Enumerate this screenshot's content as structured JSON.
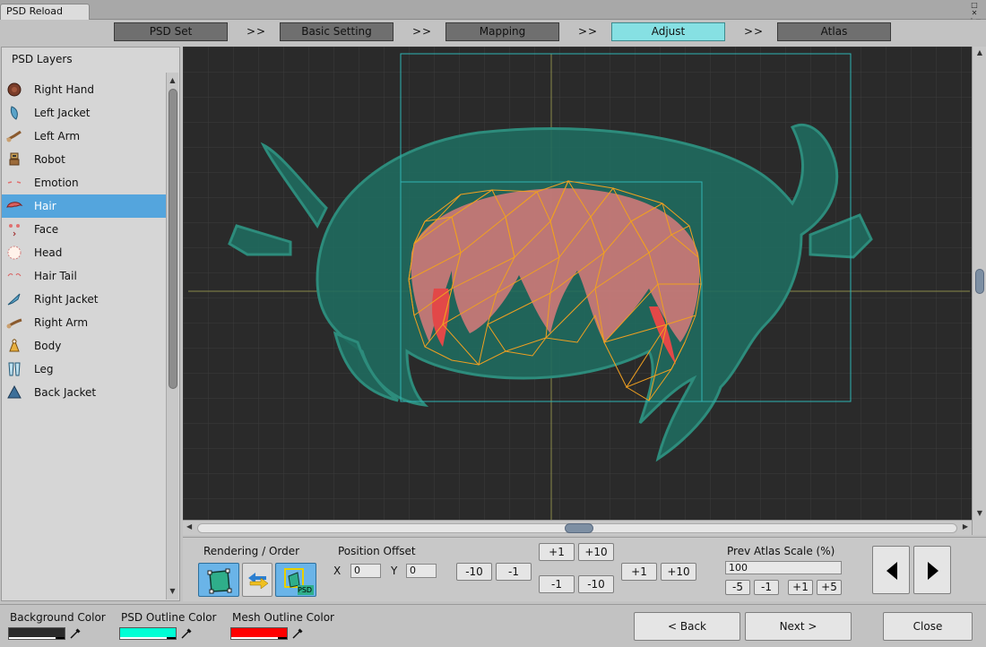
{
  "window": {
    "title": "PSD Reload"
  },
  "steps": [
    {
      "label": "PSD Set",
      "active": false
    },
    {
      "label": "Basic Setting",
      "active": false
    },
    {
      "label": "Mapping",
      "active": false
    },
    {
      "label": "Adjust",
      "active": true
    },
    {
      "label": "Atlas",
      "active": false
    }
  ],
  "step_separator": ">>",
  "layers_panel": {
    "title": "PSD Layers",
    "selected": "Hair",
    "items": [
      {
        "label": "Right Hand",
        "icon": "hand-icon"
      },
      {
        "label": "Left Jacket",
        "icon": "jacket-icon"
      },
      {
        "label": "Left Arm",
        "icon": "arm-icon"
      },
      {
        "label": "Robot",
        "icon": "robot-icon"
      },
      {
        "label": "Emotion",
        "icon": "emotion-icon"
      },
      {
        "label": "Hair",
        "icon": "hair-icon"
      },
      {
        "label": "Face",
        "icon": "face-icon"
      },
      {
        "label": "Head",
        "icon": "head-icon"
      },
      {
        "label": "Hair Tail",
        "icon": "hair-tail-icon"
      },
      {
        "label": "Right Jacket",
        "icon": "jacket-icon"
      },
      {
        "label": "Right Arm",
        "icon": "arm-icon"
      },
      {
        "label": "Body",
        "icon": "body-icon"
      },
      {
        "label": "Leg",
        "icon": "leg-icon"
      },
      {
        "label": "Back Jacket",
        "icon": "jacket-icon"
      }
    ]
  },
  "toolbar": {
    "rendering_label": "Rendering / Order",
    "position_offset_label": "Position Offset",
    "x_label": "X",
    "x_value": "0",
    "y_label": "Y",
    "y_value": "0",
    "offset_buttons": {
      "minus10": "-10",
      "minus1": "-1",
      "up_plus1": "+1",
      "up_plus10": "+10",
      "down_minus1": "-1",
      "down_minus10": "-10",
      "right_plus1": "+1",
      "right_plus10": "+10"
    },
    "psd_badge": "PSD",
    "atlas_scale_label": "Prev Atlas Scale (%)",
    "atlas_scale_value": "100",
    "scale_buttons": {
      "m5": "-5",
      "m1": "-1",
      "p1": "+1",
      "p5": "+5"
    }
  },
  "bottom": {
    "background_color_label": "Background Color",
    "psd_outline_color_label": "PSD Outline Color",
    "mesh_outline_color_label": "Mesh Outline Color",
    "colors": {
      "background": "#2a2a2a",
      "psd_outline": "#00ffd5",
      "mesh_outline": "#ff0000"
    },
    "back_label": "< Back",
    "next_label": "Next >",
    "close_label": "Close"
  }
}
